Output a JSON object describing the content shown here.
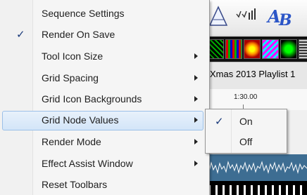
{
  "background": {
    "playlist_label": "Xmas 2013 Playlist 1",
    "ruler_time": "1:30.00",
    "toolbar_icons": [
      "triangle-icon",
      "bars-icon",
      "text-effect-icon"
    ]
  },
  "menu": {
    "items": [
      {
        "label": "Sequence Settings",
        "checked": false,
        "submenu": false
      },
      {
        "label": "Render On Save",
        "checked": true,
        "submenu": false
      },
      {
        "label": "Tool Icon Size",
        "checked": false,
        "submenu": true
      },
      {
        "label": "Grid Spacing",
        "checked": false,
        "submenu": true
      },
      {
        "label": "Grid Icon Backgrounds",
        "checked": false,
        "submenu": true
      },
      {
        "label": "Grid Node Values",
        "checked": false,
        "submenu": true,
        "highlighted": true
      },
      {
        "label": "Render Mode",
        "checked": false,
        "submenu": true
      },
      {
        "label": "Effect Assist Window",
        "checked": false,
        "submenu": true
      },
      {
        "label": "Reset Toolbars",
        "checked": false,
        "submenu": false
      }
    ],
    "check_glyph": "✓"
  },
  "submenu": {
    "items": [
      {
        "label": "On",
        "checked": true
      },
      {
        "label": "Off",
        "checked": false
      }
    ]
  },
  "colors": {
    "highlight_border": "#9cc0e8",
    "check": "#1a3a7a",
    "text_effect_icon": "#2b55c7"
  }
}
